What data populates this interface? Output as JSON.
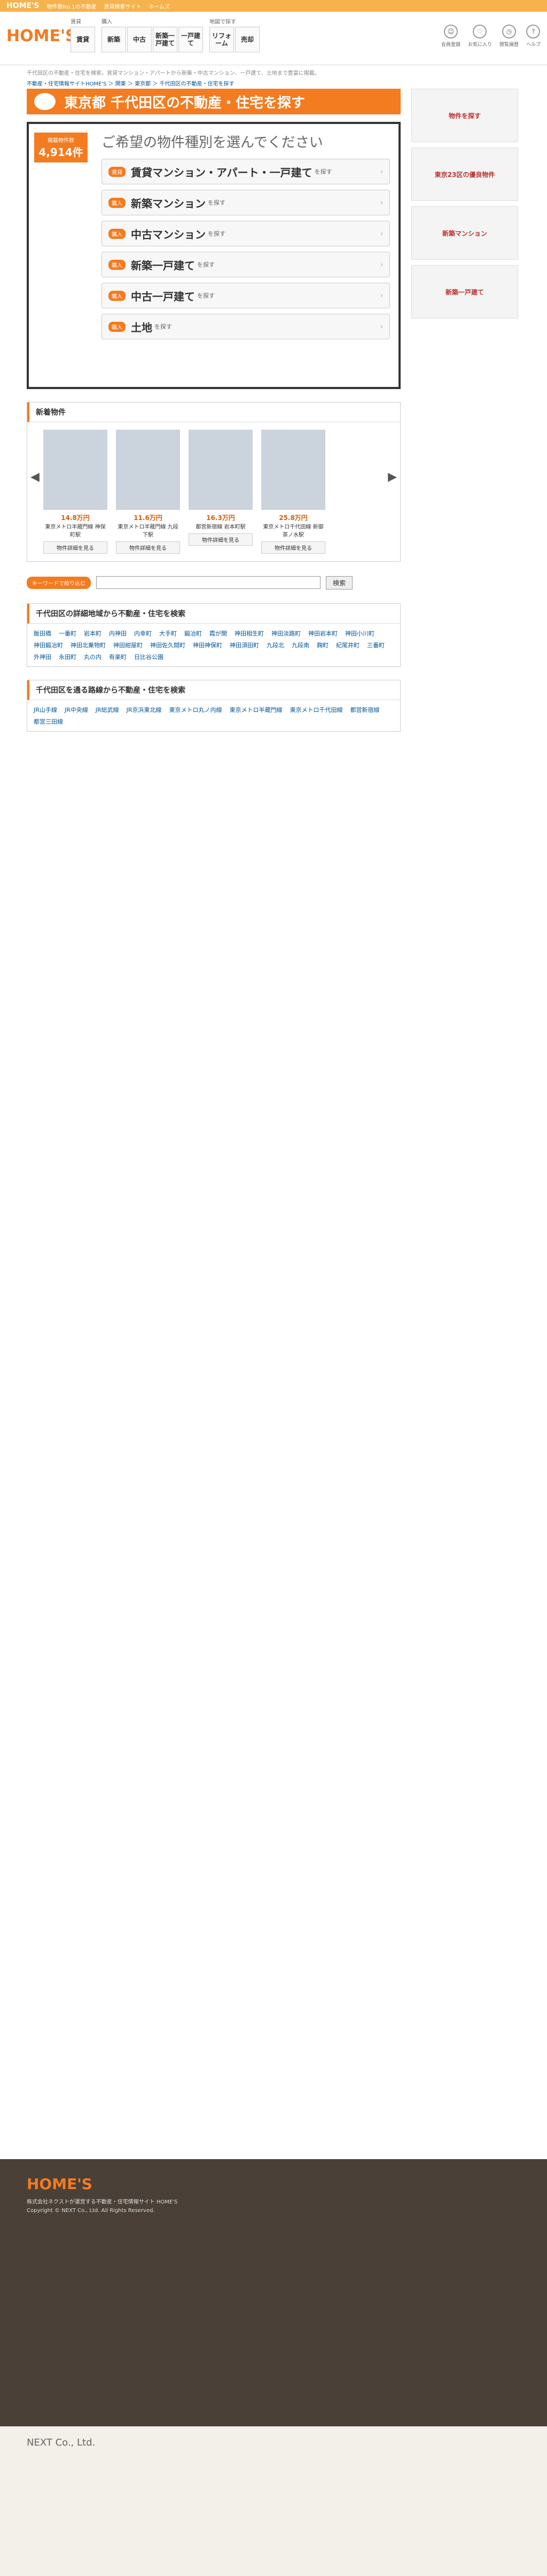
{
  "topbar": {
    "logo": "HOME'S",
    "a": "物件数No.1の不動産",
    "b": "賃貸検索サイト",
    "c": "ホームズ"
  },
  "header": {
    "logo": "HOME'S",
    "rent": "賃貸",
    "buy": "購入",
    "sell": "売却",
    "lease": "一戸建て",
    "map": "地図で探す",
    "new": "新築",
    "used": "中古",
    "house": "新築一戸建て",
    "reform": "リフォーム",
    "register": "会員登録",
    "fav": "お気に入り",
    "history": "閲覧履歴",
    "help": "ヘルプ"
  },
  "desc": "千代田区の不動産・住宅を検索。賃貸マンション・アパートから新築・中古マンション、一戸建て、土地まで豊富に掲載。",
  "crumb": "不動産・住宅情報サイトHOME'S ＞ 関東 ＞ 東京都 ＞ 千代田区の不動産・住宅を探す",
  "title": "東京都 千代田区の不動産・住宅を探す",
  "count": {
    "label": "掲載物件数",
    "value": "4,914件"
  },
  "question": "ご希望の物件種別を選んでください",
  "types": [
    {
      "tag": "賃貸",
      "name": "賃貸マンション・アパート・一戸建て",
      "sfx": "を探す"
    },
    {
      "tag": "購入",
      "name": "新築マンション",
      "sfx": "を探す"
    },
    {
      "tag": "購入",
      "name": "中古マンション",
      "sfx": "を探す"
    },
    {
      "tag": "購入",
      "name": "新築一戸建て",
      "sfx": "を探す"
    },
    {
      "tag": "購入",
      "name": "中古一戸建て",
      "sfx": "を探す"
    },
    {
      "tag": "購入",
      "name": "土地",
      "sfx": "を探す"
    }
  ],
  "newsec": "新着物件",
  "cards": [
    {
      "price": "14.8万円",
      "info": "東京メトロ半蔵門線 神保町駅",
      "btn": "物件詳細を見る"
    },
    {
      "price": "11.6万円",
      "info": "東京メトロ半蔵門線 九段下駅",
      "btn": "物件詳細を見る"
    },
    {
      "price": "16.3万円",
      "info": "都営新宿線 岩本町駅",
      "btn": "物件詳細を見る"
    },
    {
      "price": "25.8万円",
      "info": "東京メトロ千代田線 新御茶ノ水駅",
      "btn": "物件詳細を見る"
    }
  ],
  "kw": {
    "label": "キーワードで絞り込む",
    "btn": "検索"
  },
  "area_title": "千代田区の詳細地域から不動産・住宅を検索",
  "areas": [
    "飯田橋",
    "一番町",
    "岩本町",
    "内神田",
    "内幸町",
    "大手町",
    "鍛冶町",
    "霞が関",
    "神田相生町",
    "神田淡路町",
    "神田岩本町",
    "神田小川町",
    "神田鍛冶町",
    "神田北乗物町",
    "神田紺屋町",
    "神田佐久間町",
    "神田神保町",
    "神田須田町",
    "九段北",
    "九段南",
    "麹町",
    "紀尾井町",
    "三番町",
    "外神田",
    "永田町",
    "丸の内",
    "有楽町",
    "日比谷公園"
  ],
  "station_title": "千代田区を通る路線から不動産・住宅を検索",
  "stations": [
    "JR山手線",
    "JR中央線",
    "JR総武線",
    "JR京浜東北線",
    "東京メトロ丸ノ内線",
    "東京メトロ半蔵門線",
    "東京メトロ千代田線",
    "都営新宿線",
    "都営三田線"
  ],
  "foot": {
    "logo": "HOME'S",
    "text": "株式会社ネクストが運営する不動産・住宅情報サイト HOME'S",
    "copy": "Copyright © NEXT Co., Ltd. All Rights Reserved."
  },
  "next": "NEXT Co., Ltd.",
  "side": [
    "物件を探す",
    "東京23区の優良物件",
    "新築マンション",
    "新築一戸建て"
  ]
}
